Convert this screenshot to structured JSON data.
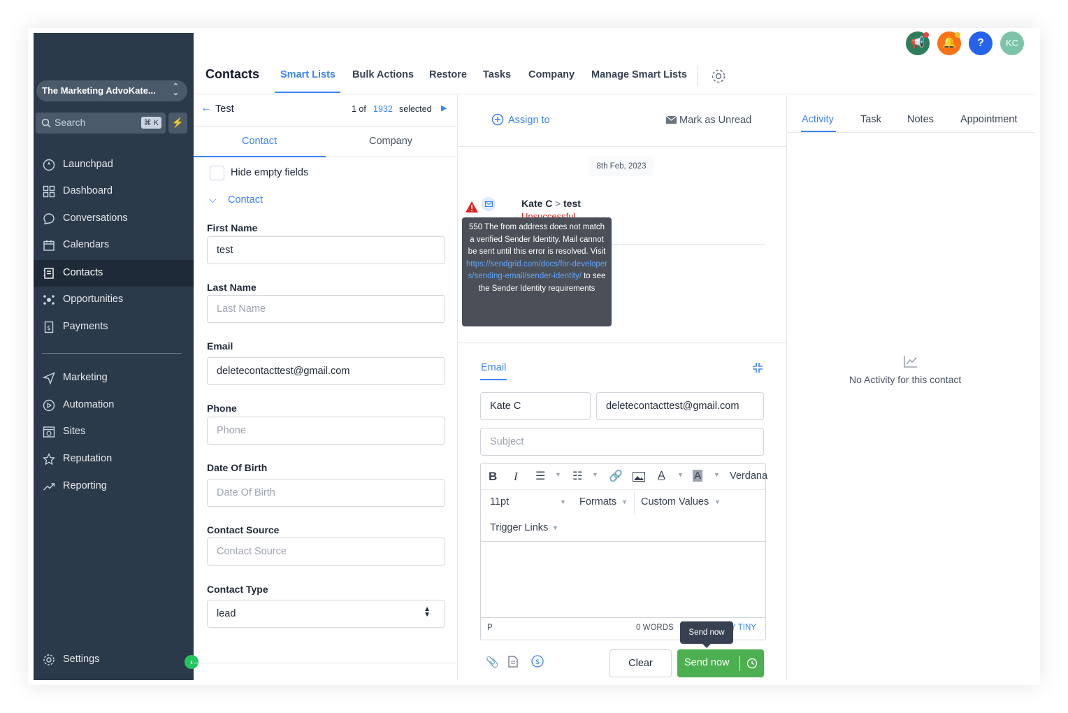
{
  "sidebar": {
    "location": "The Marketing AdvoKate...",
    "search_placeholder": "Search",
    "search_shortcut": "⌘ K",
    "items": [
      {
        "label": "Launchpad",
        "icon": "rocket-icon"
      },
      {
        "label": "Dashboard",
        "icon": "grid-icon"
      },
      {
        "label": "Conversations",
        "icon": "chat-icon"
      },
      {
        "label": "Calendars",
        "icon": "calendar-icon"
      },
      {
        "label": "Contacts",
        "icon": "contacts-icon"
      },
      {
        "label": "Opportunities",
        "icon": "network-icon"
      },
      {
        "label": "Payments",
        "icon": "receipt-icon"
      }
    ],
    "items2": [
      {
        "label": "Marketing",
        "icon": "send-icon"
      },
      {
        "label": "Automation",
        "icon": "automation-icon"
      },
      {
        "label": "Sites",
        "icon": "sites-icon"
      },
      {
        "label": "Reputation",
        "icon": "star-icon"
      },
      {
        "label": "Reporting",
        "icon": "trend-icon"
      }
    ],
    "settings": "Settings"
  },
  "topbar": {
    "avatar": "KC"
  },
  "nav": {
    "title": "Contacts",
    "tabs": [
      "Smart Lists",
      "Bulk Actions",
      "Restore",
      "Tasks",
      "Company",
      "Manage Smart Lists"
    ]
  },
  "contact_panel": {
    "back_label": "Test",
    "count_prefix": "1 of",
    "count_total": "1932",
    "count_suffix": "selected",
    "tab_contact": "Contact",
    "tab_company": "Company",
    "hide_empty": "Hide empty fields",
    "section": "Contact",
    "fields": [
      {
        "label": "First Name",
        "value": "test",
        "placeholder": ""
      },
      {
        "label": "Last Name",
        "value": "",
        "placeholder": "Last Name"
      },
      {
        "label": "Email",
        "value": "deletecontacttest@gmail.com",
        "placeholder": ""
      },
      {
        "label": "Phone",
        "value": "",
        "placeholder": "Phone"
      },
      {
        "label": "Date Of Birth",
        "value": "",
        "placeholder": "Date Of Birth"
      },
      {
        "label": "Contact Source",
        "value": "",
        "placeholder": "Contact Source"
      },
      {
        "label": "Contact Type",
        "value": "lead",
        "placeholder": ""
      }
    ]
  },
  "conversation": {
    "assign": "Assign to",
    "mark_unread": "Mark as Unread",
    "date": "8th Feb, 2023",
    "msg_sender": "Kate C",
    "msg_sep": ">",
    "msg_to": "test",
    "msg_status": "Unsuccessful",
    "tooltip_pre": "550 The from address does not match a verified Sender Identity. Mail cannot be sent until this error is resolved. Visit",
    "tooltip_link": "https://sendgrid.com/docs/for-developers/sending-email/sender-identity/",
    "tooltip_post": "to see the Sender Identity requirements",
    "compose_tab": "Email",
    "from_name": "Kate C",
    "to_email": "deletecontacttest@gmail.com",
    "subject_placeholder": "Subject",
    "font": "Verdana",
    "size": "11pt",
    "formats": "Formats",
    "custom_values": "Custom Values",
    "trigger_links": "Trigger Links",
    "status_path": "P",
    "word_count": "0 WORDS",
    "powered": "POWERED BY TINY",
    "clear": "Clear",
    "send": "Send now",
    "send_tooltip": "Send now"
  },
  "activity": {
    "tabs": [
      "Activity",
      "Task",
      "Notes",
      "Appointment"
    ],
    "empty": "No Activity for this contact"
  }
}
